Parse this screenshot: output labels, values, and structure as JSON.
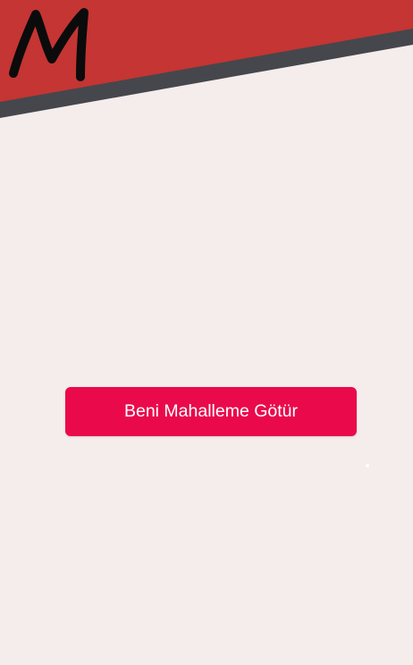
{
  "app": {
    "logo_letter": "M",
    "logo_icon": "handwritten-m-logo",
    "colors": {
      "background": "#f5ecec",
      "banner_red": "#c43533",
      "banner_stripe": "#45474c",
      "logo_ink": "#0b0b0b",
      "button": "#ea0a4b",
      "button_text": "#ffffff"
    }
  },
  "main": {
    "primary_button_label": "Beni Mahalleme Götür"
  }
}
